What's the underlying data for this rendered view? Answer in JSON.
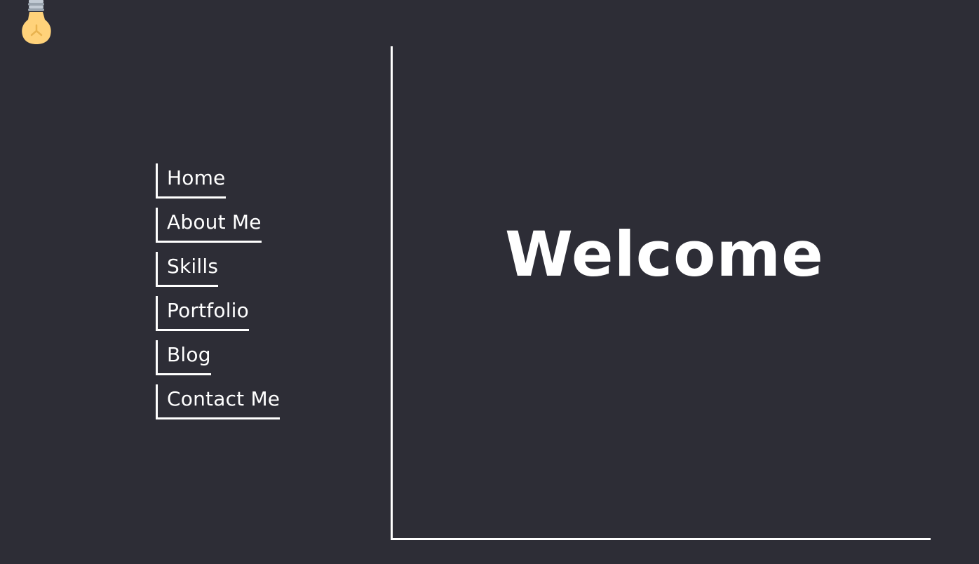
{
  "logo": {
    "icon": "light-bulb-icon"
  },
  "nav": {
    "items": [
      {
        "label": "Home"
      },
      {
        "label": "About Me"
      },
      {
        "label": "Skills"
      },
      {
        "label": "Portfolio"
      },
      {
        "label": "Blog"
      },
      {
        "label": "Contact Me"
      }
    ]
  },
  "hero": {
    "title": "Welcome"
  },
  "colors": {
    "background": "#2d2d36",
    "text": "#ffffff",
    "bulb": "#ffd27a",
    "bulb_socket": "#aab3bd"
  }
}
